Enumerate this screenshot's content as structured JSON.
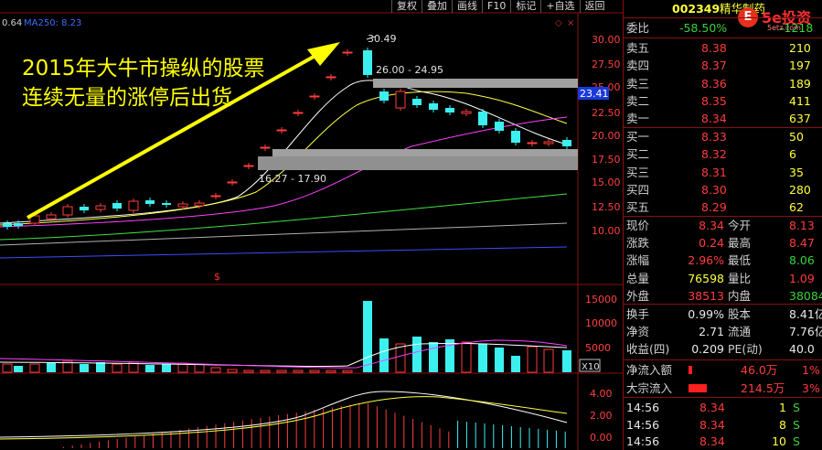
{
  "chart": {
    "top_left_value": "0.64",
    "ma_label": "MA250: 8.23",
    "price_axis": [
      "30.00",
      "27.50",
      "25.00",
      "22.50",
      "20.00",
      "17.50",
      "15.00",
      "12.50",
      "10.00"
    ],
    "current_price_tag": "23.41",
    "annotation_line1": "2015年大牛市操纵的股票",
    "annotation_line2": "连续无量的涨停后出货",
    "high_label": "30.49",
    "band_upper_label": "26.00 - 24.95",
    "band_lower_label": "16.27 - 17.90",
    "marker_symbol": "$",
    "volume_axis": [
      "15000",
      "10000",
      "5000"
    ],
    "volume_unit": "X10",
    "macd_axis": [
      "4.00",
      "2.00",
      "0.00"
    ]
  },
  "toolbar": [
    "复权",
    "叠加",
    "画线",
    "F10",
    "标记",
    "+自选",
    "返回"
  ],
  "header": {
    "code": "002349",
    "name": "精华制药",
    "logo_text": "5e投资",
    "logo_sub": "5etz.com",
    "weibi_label": "委比",
    "weibi_value": "-58.50%",
    "weicha_value": "-1218"
  },
  "sell_orders": [
    {
      "label": "卖五",
      "price": "8.38",
      "vol": "210"
    },
    {
      "label": "卖四",
      "price": "8.37",
      "vol": "197"
    },
    {
      "label": "卖三",
      "price": "8.36",
      "vol": "189"
    },
    {
      "label": "卖二",
      "price": "8.35",
      "vol": "411"
    },
    {
      "label": "卖一",
      "price": "8.34",
      "vol": "637"
    }
  ],
  "buy_orders": [
    {
      "label": "买一",
      "price": "8.33",
      "vol": "50"
    },
    {
      "label": "买二",
      "price": "8.32",
      "vol": "6"
    },
    {
      "label": "买三",
      "price": "8.31",
      "vol": "35"
    },
    {
      "label": "买四",
      "price": "8.30",
      "vol": "280"
    },
    {
      "label": "买五",
      "price": "8.29",
      "vol": "62"
    }
  ],
  "stats": [
    {
      "l1": "现价",
      "v1": "8.34",
      "c1": "red",
      "l2": "今开",
      "v2": "8.13",
      "c2": "red"
    },
    {
      "l1": "涨跌",
      "v1": "0.24",
      "c1": "red",
      "l2": "最高",
      "v2": "8.47",
      "c2": "red"
    },
    {
      "l1": "涨幅",
      "v1": "2.96%",
      "c1": "red",
      "l2": "最低",
      "v2": "8.06",
      "c2": "grn"
    },
    {
      "l1": "总量",
      "v1": "76598",
      "c1": "yel",
      "l2": "量比",
      "v2": "1.09",
      "c2": "red"
    },
    {
      "l1": "外盘",
      "v1": "38513",
      "c1": "red",
      "l2": "内盘",
      "v2": "38084",
      "c2": "grn"
    }
  ],
  "stats2": [
    {
      "l1": "换手",
      "v1": "0.99%",
      "c1": "wht",
      "l2": "股本",
      "v2": "8.41亿",
      "c2": "wht"
    },
    {
      "l1": "净资",
      "v1": "2.71",
      "c1": "wht",
      "l2": "流通",
      "v2": "7.76亿",
      "c2": "wht"
    },
    {
      "l1": "收益(四)",
      "v1": "0.209",
      "c1": "wht",
      "l2": "PE(动)",
      "v2": "40.0",
      "c2": "wht"
    }
  ],
  "flows": [
    {
      "label": "净流入额",
      "value": "46.0万",
      "pct": "1%",
      "bar": 0.15
    },
    {
      "label": "大宗流入",
      "value": "214.5万",
      "pct": "3%",
      "bar": 0.7
    }
  ],
  "trades": [
    {
      "time": "14:56",
      "price": "8.34",
      "vol": "1",
      "side": "S"
    },
    {
      "time": "14:56",
      "price": "8.34",
      "vol": "8",
      "side": "S"
    },
    {
      "time": "14:56",
      "price": "8.34",
      "vol": "10",
      "side": "S"
    }
  ],
  "colors": {
    "up": "#ff3c3c",
    "down": "#3cf0f0",
    "arrow": "#ffff00",
    "panel_border": "#8a1010"
  }
}
